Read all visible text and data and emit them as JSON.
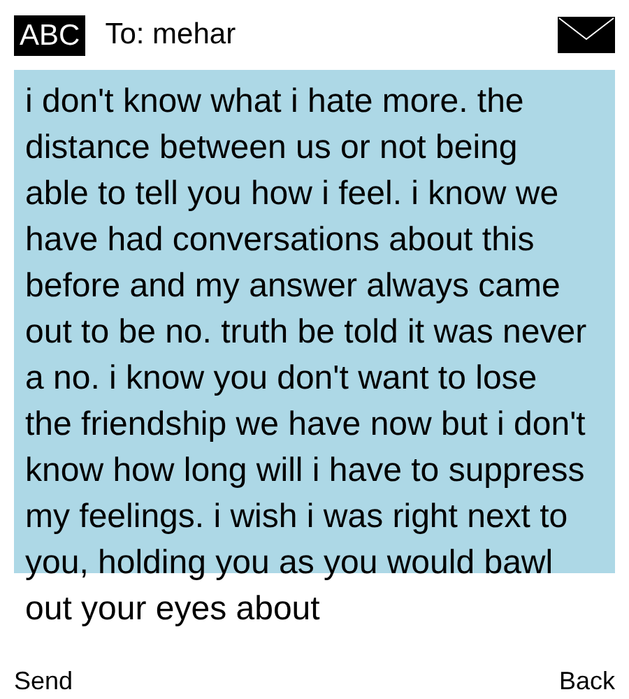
{
  "header": {
    "input_mode": "ABC",
    "recipient": "To: mehar"
  },
  "message": {
    "text": "i don't know what i hate more. the distance between us or not being able to tell you how i feel. i know we have had conversations about this before and my answer always came out to be no. truth be told it was never a no. i know you don't want to lose the friendship we have now but i don't know how long will i have to suppress my feelings. i wish i was right next to you, holding you as you would bawl out your eyes about"
  },
  "softkeys": {
    "left": "Send",
    "right": "Back"
  }
}
